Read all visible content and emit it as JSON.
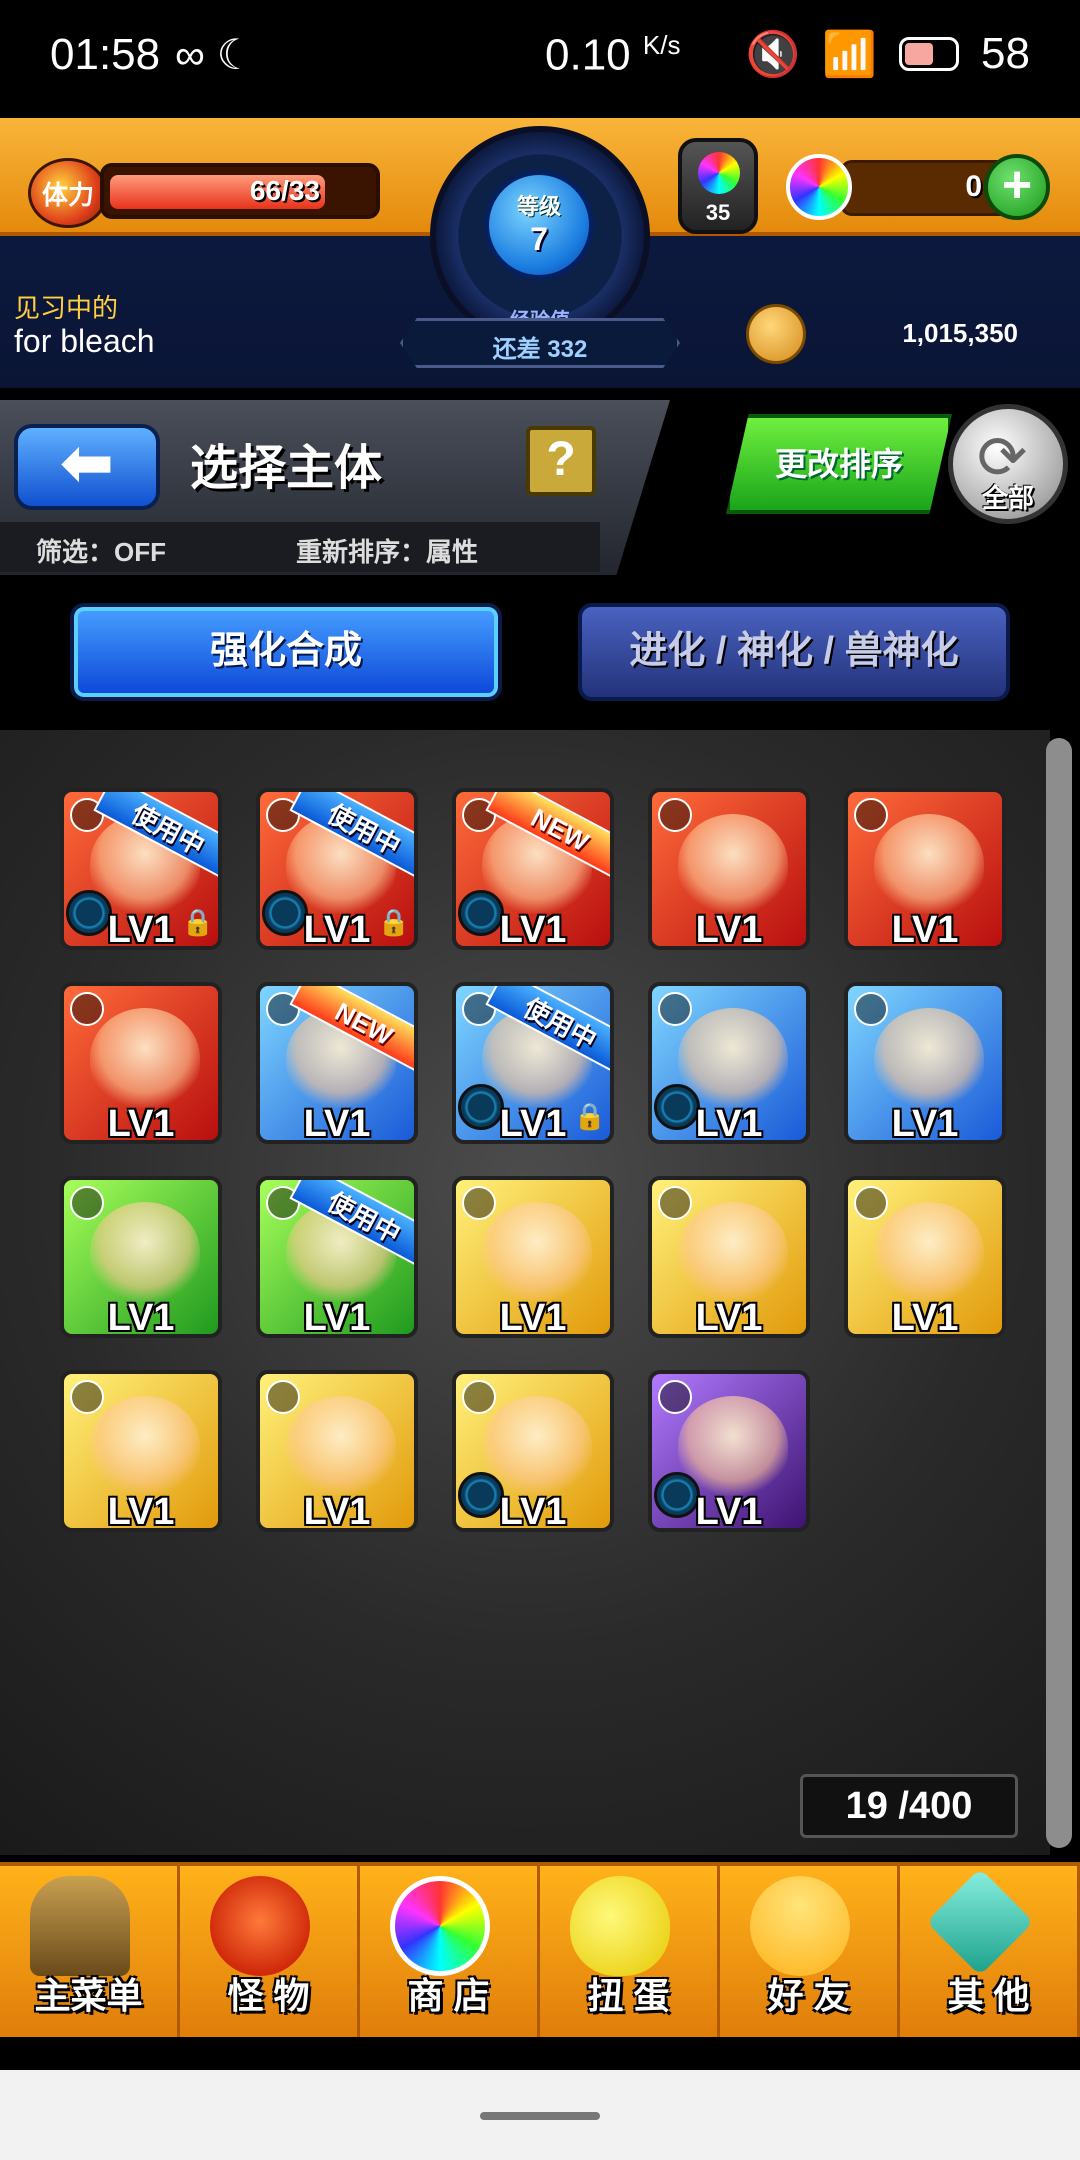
{
  "status_bar": {
    "time": "01:58",
    "net_speed": "0.10",
    "net_unit": "K/s",
    "battery": "58"
  },
  "hud": {
    "stamina_label": "体力",
    "stamina_text": "66/33",
    "stamina_fill_fraction": 0.86,
    "level_label": "等级",
    "level": "7",
    "exp_label": "经验值",
    "exp_remaining": "还差 332",
    "potion_count": "35",
    "orb_count": "0",
    "training_label": "见习中的",
    "player_name": "for bleach",
    "coins": "1,015,350"
  },
  "header": {
    "title": "选择主体",
    "help": "?",
    "filter": "筛选：OFF",
    "sort": "重新排序：属性",
    "sort_button": "更改排序",
    "refresh_label": "全部"
  },
  "tabs": [
    {
      "label": "强化合成",
      "active": true
    },
    {
      "label": "进化 / 神化 / 兽神化",
      "active": false
    }
  ],
  "monsters": [
    {
      "element": "fire",
      "level": "LV1",
      "ribbon": "使用中",
      "ribbon_type": "inuse",
      "locked": true,
      "slot": true
    },
    {
      "element": "fire",
      "level": "LV1",
      "ribbon": "使用中",
      "ribbon_type": "inuse",
      "locked": true,
      "slot": true
    },
    {
      "element": "fire",
      "level": "LV1",
      "ribbon": "NEW",
      "ribbon_type": "new",
      "locked": false,
      "slot": true
    },
    {
      "element": "fire",
      "level": "LV1",
      "ribbon": "",
      "ribbon_type": "",
      "locked": false,
      "slot": false
    },
    {
      "element": "fire",
      "level": "LV1",
      "ribbon": "",
      "ribbon_type": "",
      "locked": false,
      "slot": false
    },
    {
      "element": "fire",
      "level": "LV1",
      "ribbon": "",
      "ribbon_type": "",
      "locked": false,
      "slot": false
    },
    {
      "element": "water",
      "level": "LV1",
      "ribbon": "NEW",
      "ribbon_type": "new",
      "locked": false,
      "slot": false
    },
    {
      "element": "water",
      "level": "LV1",
      "ribbon": "使用中",
      "ribbon_type": "inuse",
      "locked": true,
      "slot": true
    },
    {
      "element": "water",
      "level": "LV1",
      "ribbon": "",
      "ribbon_type": "",
      "locked": false,
      "slot": true
    },
    {
      "element": "water",
      "level": "LV1",
      "ribbon": "",
      "ribbon_type": "",
      "locked": false,
      "slot": false
    },
    {
      "element": "wood",
      "level": "LV1",
      "ribbon": "",
      "ribbon_type": "",
      "locked": false,
      "slot": false
    },
    {
      "element": "wood",
      "level": "LV1",
      "ribbon": "使用中",
      "ribbon_type": "inuse",
      "locked": false,
      "slot": false
    },
    {
      "element": "light",
      "level": "LV1",
      "ribbon": "",
      "ribbon_type": "",
      "locked": false,
      "slot": false
    },
    {
      "element": "light",
      "level": "LV1",
      "ribbon": "",
      "ribbon_type": "",
      "locked": false,
      "slot": false
    },
    {
      "element": "light",
      "level": "LV1",
      "ribbon": "",
      "ribbon_type": "",
      "locked": false,
      "slot": false
    },
    {
      "element": "light",
      "level": "LV1",
      "ribbon": "",
      "ribbon_type": "",
      "locked": false,
      "slot": false
    },
    {
      "element": "light",
      "level": "LV1",
      "ribbon": "",
      "ribbon_type": "",
      "locked": false,
      "slot": false
    },
    {
      "element": "light",
      "level": "LV1",
      "ribbon": "",
      "ribbon_type": "",
      "locked": false,
      "slot": true
    },
    {
      "element": "dark",
      "level": "LV1",
      "ribbon": "",
      "ribbon_type": "",
      "locked": false,
      "slot": true
    }
  ],
  "box_count": "19 /400",
  "bottom_nav": [
    {
      "label": "主菜单",
      "icon": "home-icon"
    },
    {
      "label": "怪 物",
      "icon": "monster-icon"
    },
    {
      "label": "商 店",
      "icon": "shop-icon"
    },
    {
      "label": "扭 蛋",
      "icon": "gacha-icon"
    },
    {
      "label": "好 友",
      "icon": "friends-icon"
    },
    {
      "label": "其 他",
      "icon": "other-icon"
    }
  ]
}
